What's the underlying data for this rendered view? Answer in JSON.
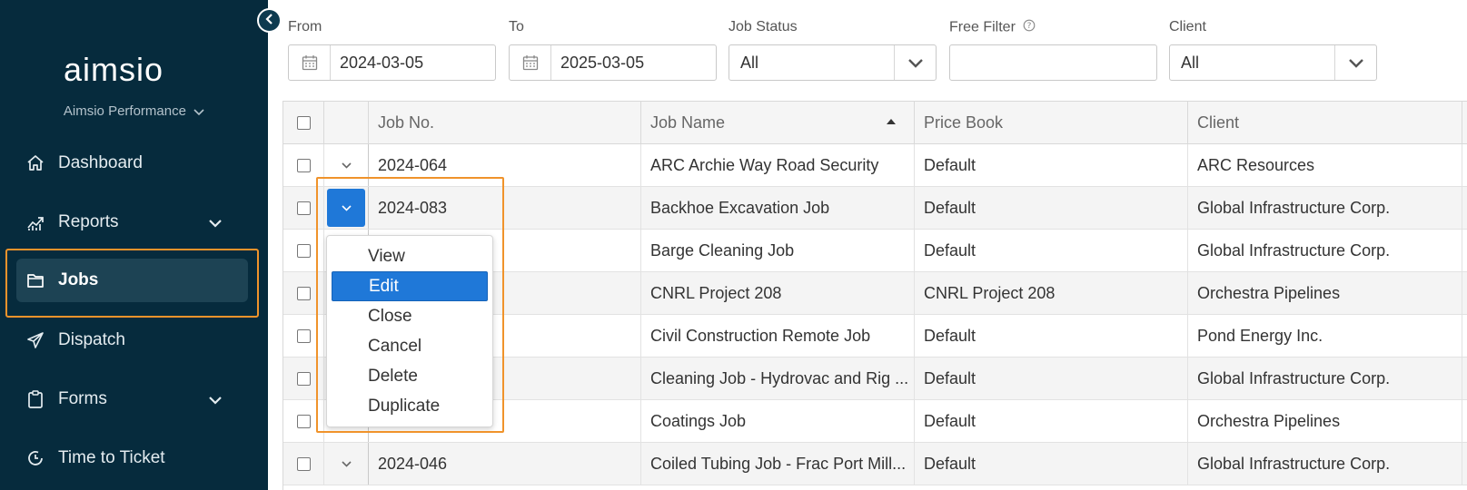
{
  "sidebar": {
    "logo_text": "aimsio",
    "org": "Aimsio Performance",
    "items": [
      {
        "label": "Dashboard",
        "icon": "home-icon",
        "has_chevron": false,
        "active": false
      },
      {
        "label": "Reports",
        "icon": "chart-icon",
        "has_chevron": true,
        "active": false
      },
      {
        "label": "Jobs",
        "icon": "folder-icon",
        "has_chevron": false,
        "active": true
      },
      {
        "label": "Dispatch",
        "icon": "send-icon",
        "has_chevron": false,
        "active": false
      },
      {
        "label": "Forms",
        "icon": "clipboard-icon",
        "has_chevron": true,
        "active": false
      },
      {
        "label": "Time to Ticket",
        "icon": "time-icon",
        "has_chevron": false,
        "active": false
      }
    ]
  },
  "filters": {
    "from_label": "From",
    "from_value": "2024-03-05",
    "to_label": "To",
    "to_value": "2025-03-05",
    "status_label": "Job Status",
    "status_value": "All",
    "free_label": "Free Filter",
    "free_value": "",
    "client_label": "Client",
    "client_value": "All"
  },
  "table": {
    "columns": [
      "Job No.",
      "Job Name",
      "Price Book",
      "Client"
    ],
    "rows": [
      {
        "no": "2024-064",
        "name": "ARC Archie Way Road Security",
        "price_book": "Default",
        "client": "ARC Resources"
      },
      {
        "no": "2024-083",
        "name": "Backhoe Excavation Job",
        "price_book": "Default",
        "client": "Global Infrastructure Corp."
      },
      {
        "no": "",
        "name": "Barge Cleaning Job",
        "price_book": "Default",
        "client": "Global Infrastructure Corp."
      },
      {
        "no": "",
        "name": "CNRL Project 208",
        "price_book": "CNRL Project 208",
        "client": "Orchestra Pipelines"
      },
      {
        "no": "",
        "name": "Civil Construction Remote Job",
        "price_book": "Default",
        "client": "Pond Energy Inc."
      },
      {
        "no": "",
        "name": "Cleaning Job - Hydrovac and Rig ...",
        "price_book": "Default",
        "client": "Global Infrastructure Corp."
      },
      {
        "no": "",
        "name": "Coatings Job",
        "price_book": "Default",
        "client": "Orchestra Pipelines"
      },
      {
        "no": "2024-046",
        "name": "Coiled Tubing Job - Frac Port Mill...",
        "price_book": "Default",
        "client": "Global Infrastructure Corp."
      }
    ]
  },
  "menu": {
    "items": [
      "View",
      "Edit",
      "Close",
      "Cancel",
      "Delete",
      "Duplicate"
    ],
    "selected": "Edit"
  },
  "colors": {
    "sidebar_bg": "#062b3d",
    "accent_blue": "#1f78d8",
    "highlight_orange": "#f0932b"
  }
}
